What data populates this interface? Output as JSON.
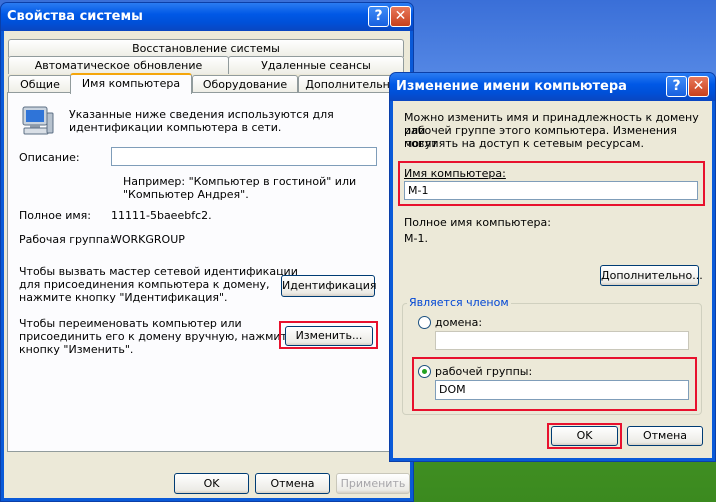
{
  "main_window": {
    "title": "Свойства системы",
    "help_glyph": "?",
    "close_glyph": "✕",
    "tabs_row1": [
      "Восстановление системы"
    ],
    "tabs_row2": [
      "Автоматическое обновление",
      "Удаленные сеансы"
    ],
    "tabs_row3": [
      "Общие",
      "Имя компьютера",
      "Оборудование",
      "Дополнительно"
    ],
    "info_line1": "Указанные ниже сведения используются для",
    "info_line2": "идентификации компьютера в сети.",
    "description_label": "Описание:",
    "description_value": "",
    "example_line1": "Например: \"Компьютер в гостиной\" или",
    "example_line2": "\"Компьютер Андрея\".",
    "full_name_label": "Полное имя:",
    "full_name_value": "11111-5baeebfc2.",
    "workgroup_label": "Рабочая группа:",
    "workgroup_value": "WORKGROUP",
    "wizard_line1": "Чтобы вызвать мастер сетевой идентификации",
    "wizard_line2": "для присоединения компьютера к домену,",
    "wizard_line3": "нажмите кнопку \"Идентификация\".",
    "identify_button": "Идентификация",
    "rename_line1": "Чтобы переименовать компьютер или",
    "rename_line2": "присоединить его к домену вручную, нажмите",
    "rename_line3": "кнопку \"Изменить\".",
    "change_button": "Изменить...",
    "ok_button": "OK",
    "cancel_button": "Отмена",
    "apply_button": "Применить"
  },
  "dialog": {
    "title": "Изменение имени компьютера",
    "help_glyph": "?",
    "close_glyph": "✕",
    "info_line1": "Можно изменить имя и принадлежность к домену или",
    "info_line2": "рабочей группе этого компьютера. Изменения могут",
    "info_line3": "повлиять на доступ к сетевым ресурсам.",
    "computer_name_label": "Имя компьютера:",
    "computer_name_value": "M-1",
    "full_name_label": "Полное имя компьютера:",
    "full_name_value": "M-1.",
    "more_button": "Дополнительно...",
    "member_of_legend": "Является членом",
    "domain_label": "домена:",
    "domain_value": "",
    "workgroup_label": "рабочей группы:",
    "workgroup_value": "DOM",
    "ok_button": "OK",
    "cancel_button": "Отмена"
  },
  "colors": {
    "highlight": "#e8112d",
    "titlebar": "#0058e6",
    "window_face": "#ece9d8"
  },
  "icons": [
    "computer-icon",
    "help-icon",
    "close-icon"
  ]
}
